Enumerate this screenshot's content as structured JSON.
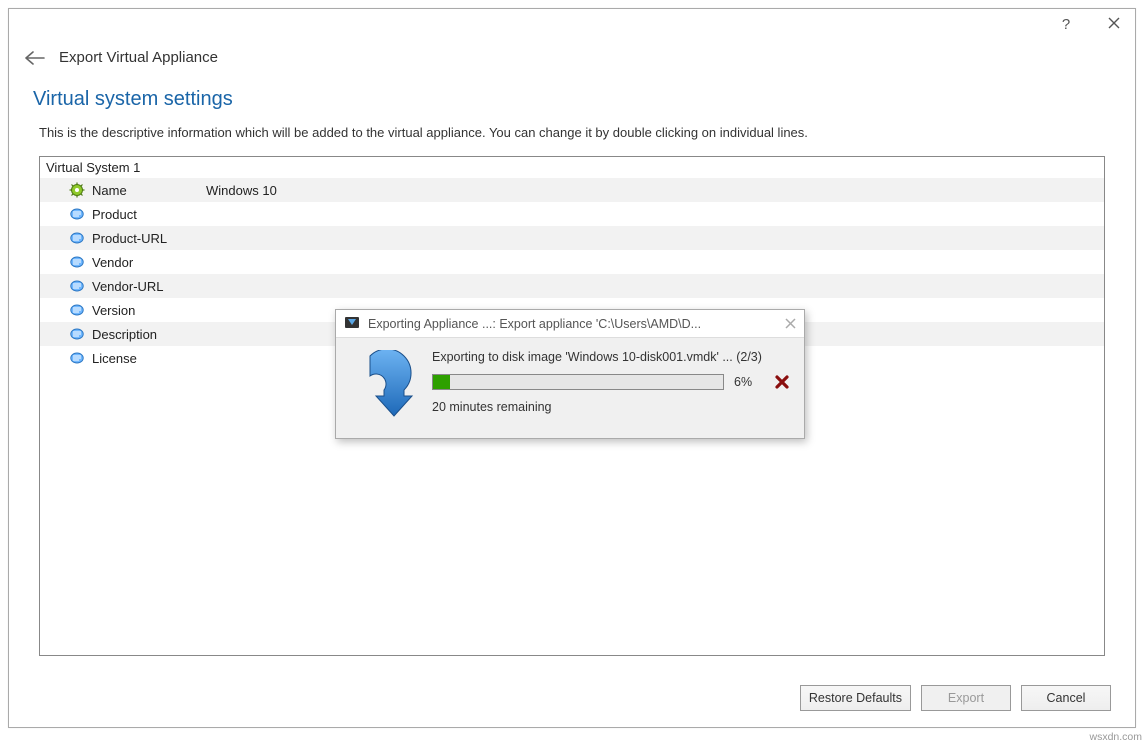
{
  "window": {
    "page_title": "Export Virtual Appliance",
    "section_heading": "Virtual system settings",
    "section_description": "This is the descriptive information which will be added to the virtual appliance. You can change it by double clicking on individual lines."
  },
  "settings": {
    "group_header": "Virtual System 1",
    "rows": [
      {
        "label": "Name",
        "value": "Windows 10",
        "icon": "gear"
      },
      {
        "label": "Product",
        "value": "",
        "icon": "doc"
      },
      {
        "label": "Product-URL",
        "value": "",
        "icon": "doc"
      },
      {
        "label": "Vendor",
        "value": "",
        "icon": "doc"
      },
      {
        "label": "Vendor-URL",
        "value": "",
        "icon": "doc"
      },
      {
        "label": "Version",
        "value": "",
        "icon": "doc"
      },
      {
        "label": "Description",
        "value": "",
        "icon": "doc"
      },
      {
        "label": "License",
        "value": "",
        "icon": "doc"
      }
    ]
  },
  "buttons": {
    "restore": "Restore Defaults",
    "export": "Export",
    "cancel": "Cancel"
  },
  "progress": {
    "title": "Exporting Appliance ...: Export appliance 'C:\\Users\\AMD\\D...",
    "line1": "Exporting to disk image 'Windows 10-disk001.vmdk' ... (2/3)",
    "percent_label": "6%",
    "percent_value": 6,
    "remaining": "20 minutes remaining"
  },
  "watermark": "wsxdn.com"
}
